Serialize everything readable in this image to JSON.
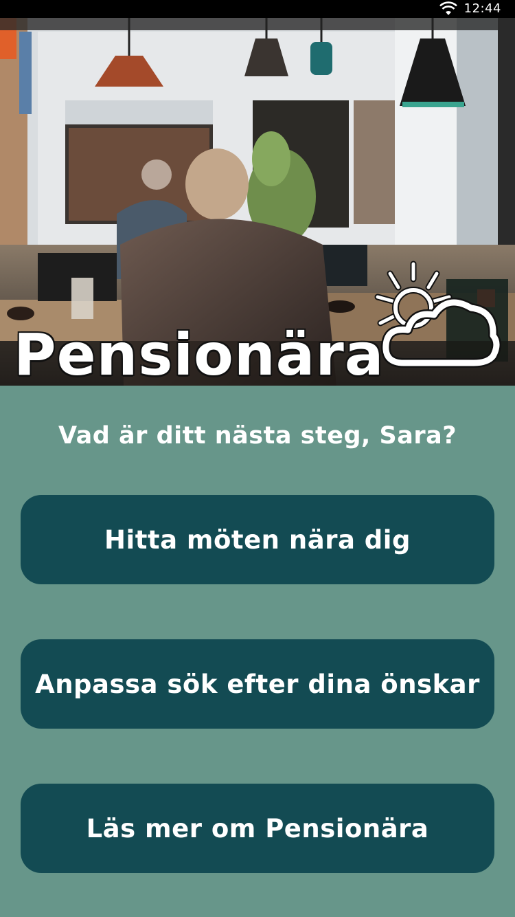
{
  "status_bar": {
    "time": "12:44",
    "icons": [
      "wifi-icon"
    ]
  },
  "header": {
    "brand_name": "Pensionära",
    "logo_icon": "sun-cloud-icon"
  },
  "main": {
    "question": "Vad är ditt nästa steg, Sara?",
    "actions": [
      {
        "label": "Hitta möten nära dig"
      },
      {
        "label": "Anpassa sök efter dina önskar"
      },
      {
        "label": "Läs mer om Pensionära"
      }
    ]
  },
  "colors": {
    "background": "#67968a",
    "button": "#134b53",
    "text": "#ffffff"
  }
}
